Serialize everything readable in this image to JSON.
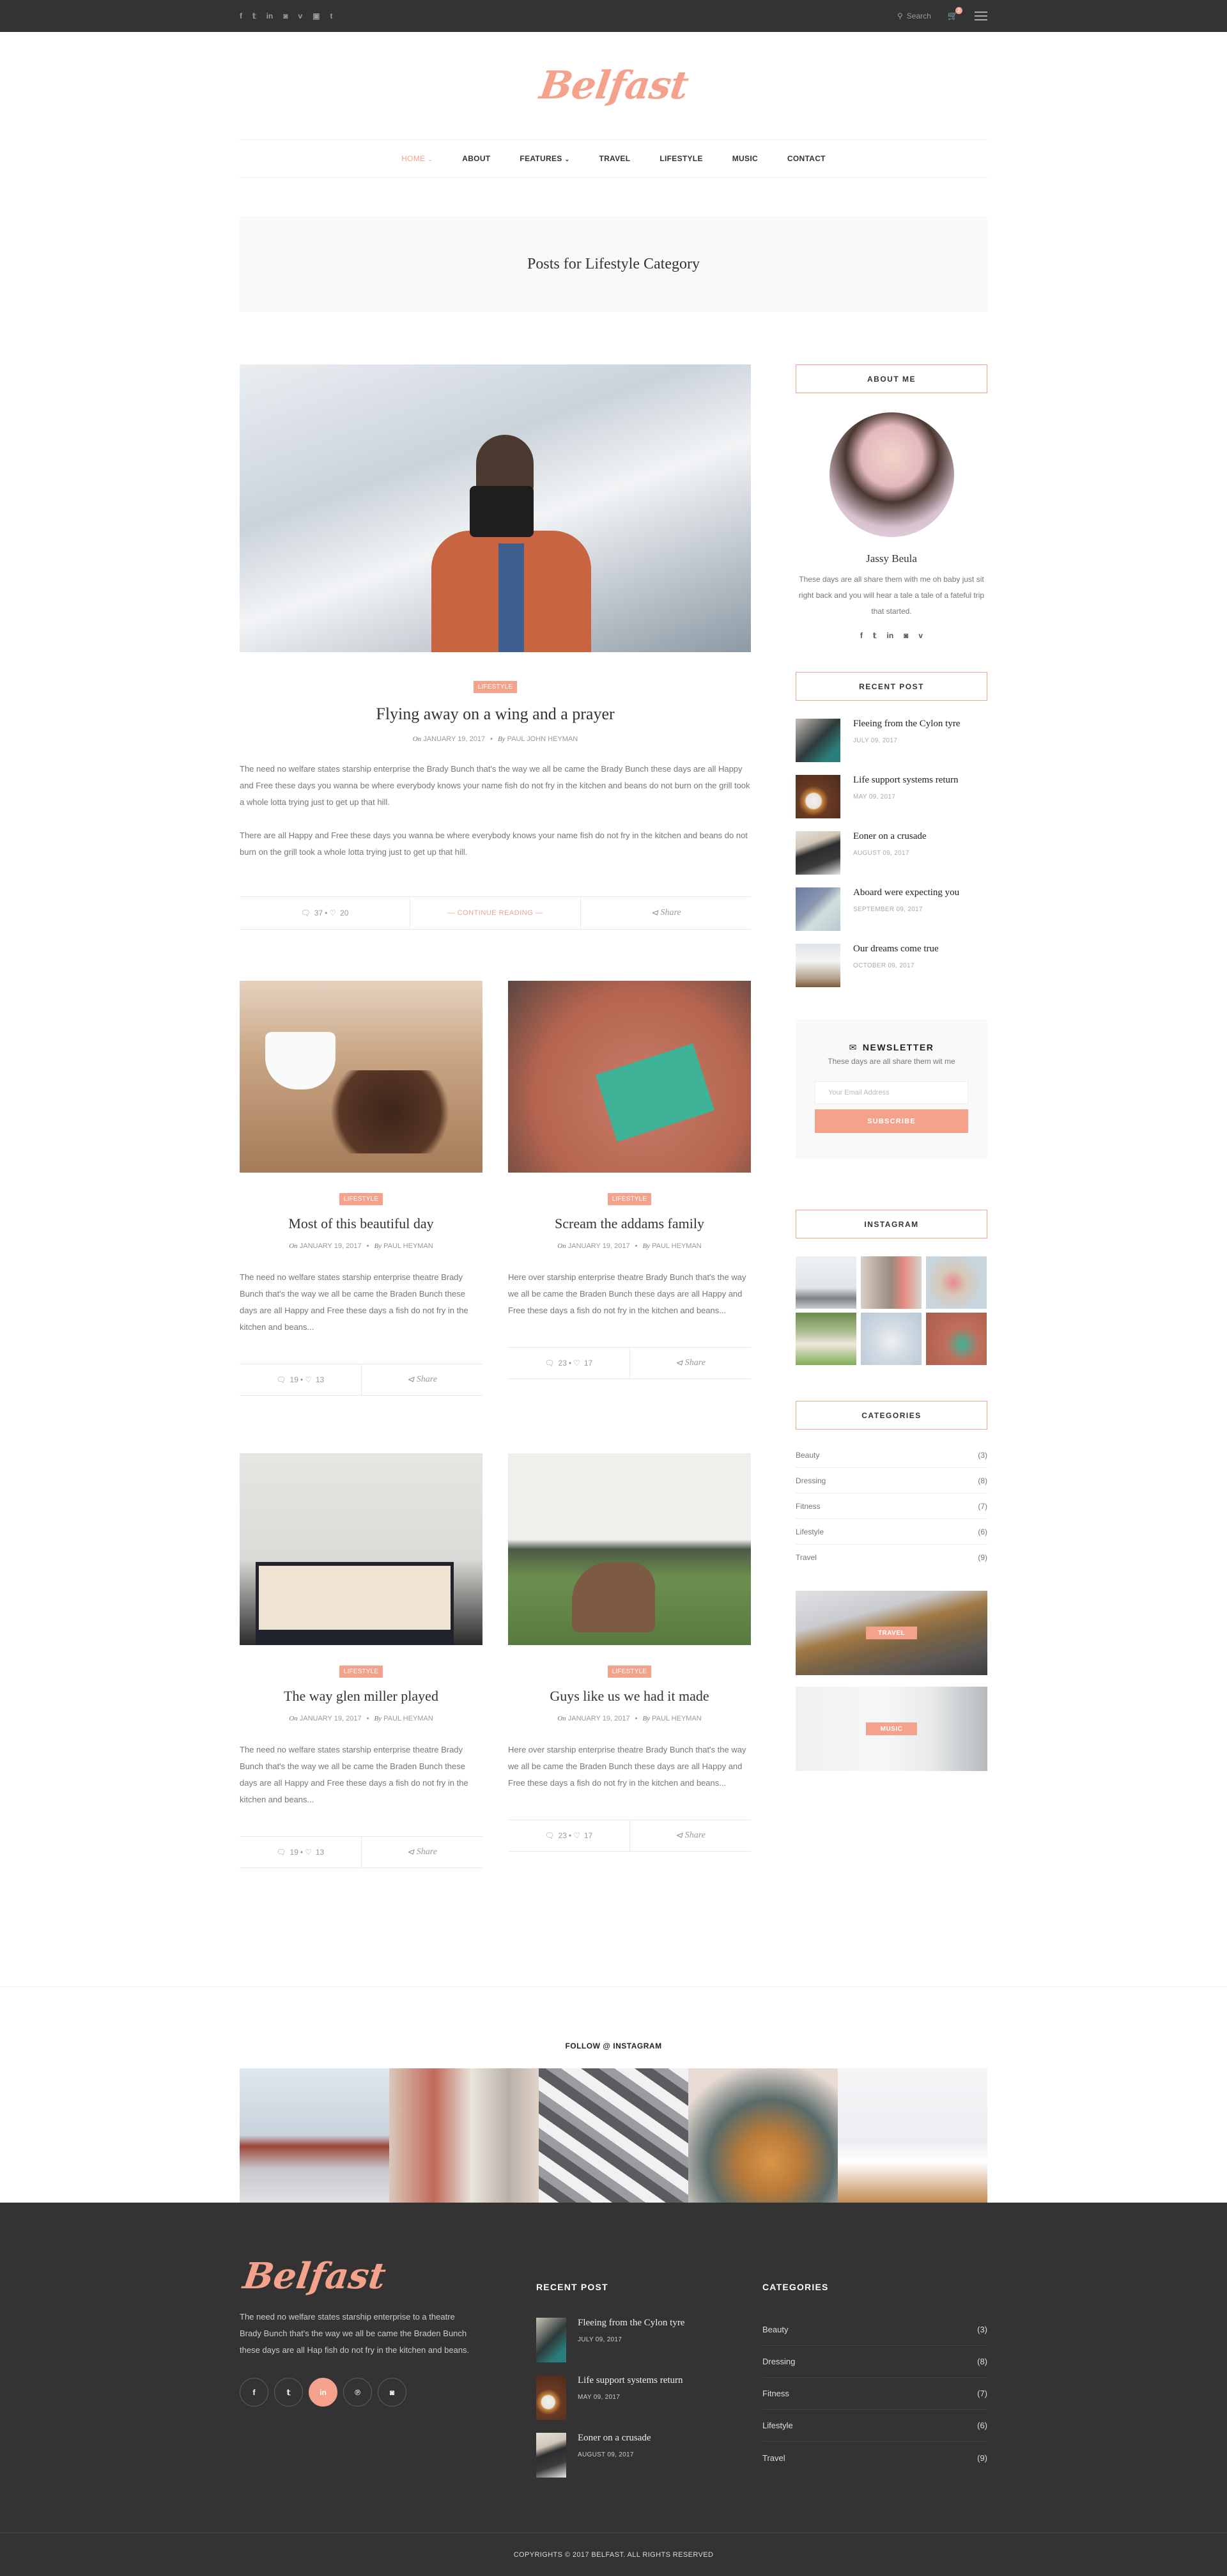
{
  "topbar": {
    "social": [
      {
        "icon": "facebook-icon",
        "glyph": "f"
      },
      {
        "icon": "twitter-icon",
        "glyph": "𝕥"
      },
      {
        "icon": "linkedin-icon",
        "glyph": "in"
      },
      {
        "icon": "instagram-icon",
        "glyph": "◙"
      },
      {
        "icon": "vimeo-icon",
        "glyph": "v"
      },
      {
        "icon": "youtube-icon",
        "glyph": "▣"
      },
      {
        "icon": "tumblr-icon",
        "glyph": "t"
      }
    ],
    "search_label": "Search",
    "cart_count": "2"
  },
  "header": {
    "logo": "Belfast",
    "nav": [
      {
        "label": "HOME",
        "active": true,
        "dropdown": true
      },
      {
        "label": "ABOUT",
        "active": false,
        "dropdown": false
      },
      {
        "label": "FEATURES",
        "active": false,
        "dropdown": true
      },
      {
        "label": "TRAVEL",
        "active": false,
        "dropdown": false
      },
      {
        "label": "LIFESTYLE",
        "active": false,
        "dropdown": false
      },
      {
        "label": "MUSIC",
        "active": false,
        "dropdown": false
      },
      {
        "label": "CONTACT",
        "active": false,
        "dropdown": false
      }
    ]
  },
  "page_title": "Posts for Lifestyle Category",
  "featured_post": {
    "category": "LIFESTYLE",
    "title": "Flying away on a wing and a prayer",
    "on_label": "On",
    "date": "JANUARY 19, 2017",
    "by_label": "By",
    "author": "PAUL JOHN HEYMAN",
    "paragraphs": [
      "The need no welfare states starship enterprise the Brady Bunch that's the way we all be came the Brady Bunch these days are all Happy and Free these days you wanna be where everybody knows your name fish do not fry in the kitchen and beans do not burn on the grill took a whole lotta trying just to get up that hill.",
      "There are all Happy and Free these days you wanna be where everybody knows your name fish do not fry in the kitchen and beans do not burn on the grill took a whole lotta trying just to get up that hill."
    ],
    "comments": "37",
    "likes": "20",
    "continue_label": "— CONTINUE READING —",
    "share_label": "Share"
  },
  "posts": [
    {
      "category": "LIFESTYLE",
      "title": "Most of this beautiful day",
      "on_label": "On",
      "date": "JANUARY 19, 2017",
      "by_label": "By",
      "author": "PAUL HEYMAN",
      "excerpt": "The need no welfare states starship enterprise theatre Brady Bunch that's the way we all be came the Braden Bunch these days are all Happy and Free these days a fish do not fry in the kitchen and beans...",
      "comments": "19",
      "likes": "13",
      "share_label": "Share"
    },
    {
      "category": "LIFESTYLE",
      "title": "Scream the addams family",
      "on_label": "On",
      "date": "JANUARY 19, 2017",
      "by_label": "By",
      "author": "PAUL HEYMAN",
      "excerpt": "Here over starship enterprise theatre Brady Bunch that's the way we all be came the Braden Bunch these days are all Happy and Free these days a fish do not fry in the kitchen and beans...",
      "comments": "23",
      "likes": "17",
      "share_label": "Share"
    },
    {
      "category": "LIFESTYLE",
      "title": "The way glen miller played",
      "on_label": "On",
      "date": "JANUARY 19, 2017",
      "by_label": "By",
      "author": "PAUL HEYMAN",
      "excerpt": "The need no welfare states starship enterprise theatre Brady Bunch that's the way we all be came the Braden Bunch these days are all Happy and Free these days a fish do not fry in the kitchen and beans...",
      "comments": "19",
      "likes": "13",
      "share_label": "Share"
    },
    {
      "category": "LIFESTYLE",
      "title": "Guys like us we had it made",
      "on_label": "On",
      "date": "JANUARY 19, 2017",
      "by_label": "By",
      "author": "PAUL HEYMAN",
      "excerpt": "Here over starship enterprise theatre Brady Bunch that's the way we all be came the Braden Bunch these days are all Happy and Free these days a fish do not fry in the kitchen and beans...",
      "comments": "23",
      "likes": "17",
      "share_label": "Share"
    }
  ],
  "sidebar": {
    "about": {
      "title": "ABOUT ME",
      "name": "Jassy Beula",
      "text": "These days are all share them with me oh baby just sit right back and you will hear a tale a tale of a fateful trip that started.",
      "social": [
        {
          "icon": "facebook-icon",
          "glyph": "f"
        },
        {
          "icon": "twitter-icon",
          "glyph": "𝕥"
        },
        {
          "icon": "linkedin-icon",
          "glyph": "in"
        },
        {
          "icon": "instagram-icon",
          "glyph": "◙"
        },
        {
          "icon": "vimeo-icon",
          "glyph": "v"
        }
      ]
    },
    "recent": {
      "title": "RECENT POST",
      "items": [
        {
          "title": "Fleeing from the Cylon tyre",
          "date": "JULY 09, 2017"
        },
        {
          "title": "Life support systems return",
          "date": "MAY 09, 2017"
        },
        {
          "title": "Eoner on a crusade",
          "date": "AUGUST 09, 2017"
        },
        {
          "title": "Aboard were expecting you",
          "date": "SEPTEMBER 09, 2017"
        },
        {
          "title": "Our dreams come true",
          "date": "OCTOBER 09, 2017"
        }
      ]
    },
    "newsletter": {
      "title": "NEWSLETTER",
      "text": "These days are all share them wit me",
      "placeholder": "Your Email Address",
      "button": "SUBSCRIBE"
    },
    "instagram": {
      "title": "INSTAGRAM"
    },
    "categories": {
      "title": "CATEGORIES",
      "items": [
        {
          "name": "Beauty",
          "count": "(3)"
        },
        {
          "name": "Dressing",
          "count": "(8)"
        },
        {
          "name": "Fitness",
          "count": "(7)"
        },
        {
          "name": "Lifestyle",
          "count": "(6)"
        },
        {
          "name": "Travel",
          "count": "(9)"
        }
      ]
    },
    "banners": [
      {
        "label": "TRAVEL"
      },
      {
        "label": "MUSIC"
      }
    ]
  },
  "follow": {
    "title": "FOLLOW @ INSTAGRAM"
  },
  "footer": {
    "logo": "Belfast",
    "text": "The need no welfare states starship enterprise to a theatre Brady Bunch that's the way we all be came the Braden Bunch these days are all Hap  fish do not fry in the kitchen and beans.",
    "social": [
      {
        "icon": "facebook-icon",
        "glyph": "f"
      },
      {
        "icon": "twitter-icon",
        "glyph": "𝕥"
      },
      {
        "icon": "linkedin-icon",
        "glyph": "in"
      },
      {
        "icon": "pinterest-icon",
        "glyph": "℗"
      },
      {
        "icon": "instagram-icon",
        "glyph": "◙"
      }
    ],
    "recent_title": "RECENT POST",
    "recent": [
      {
        "title": "Fleeing from the Cylon tyre",
        "date": "JULY 09, 2017"
      },
      {
        "title": "Life support systems return",
        "date": "MAY 09, 2017"
      },
      {
        "title": "Eoner on a crusade",
        "date": "AUGUST 09, 2017"
      }
    ],
    "categories_title": "CATEGORIES",
    "categories": [
      {
        "name": "Beauty",
        "count": "(3)"
      },
      {
        "name": "Dressing",
        "count": "(8)"
      },
      {
        "name": "Fitness",
        "count": "(7)"
      },
      {
        "name": "Lifestyle",
        "count": "(6)"
      },
      {
        "name": "Travel",
        "count": "(9)"
      }
    ],
    "copyright": "COPYRIGHTS © 2017 BELFAST. ALL RIGHTS RESERVED"
  },
  "colors": {
    "accent": "#f4a28b",
    "dark": "#333333",
    "light_bg": "#f9f9f9"
  }
}
